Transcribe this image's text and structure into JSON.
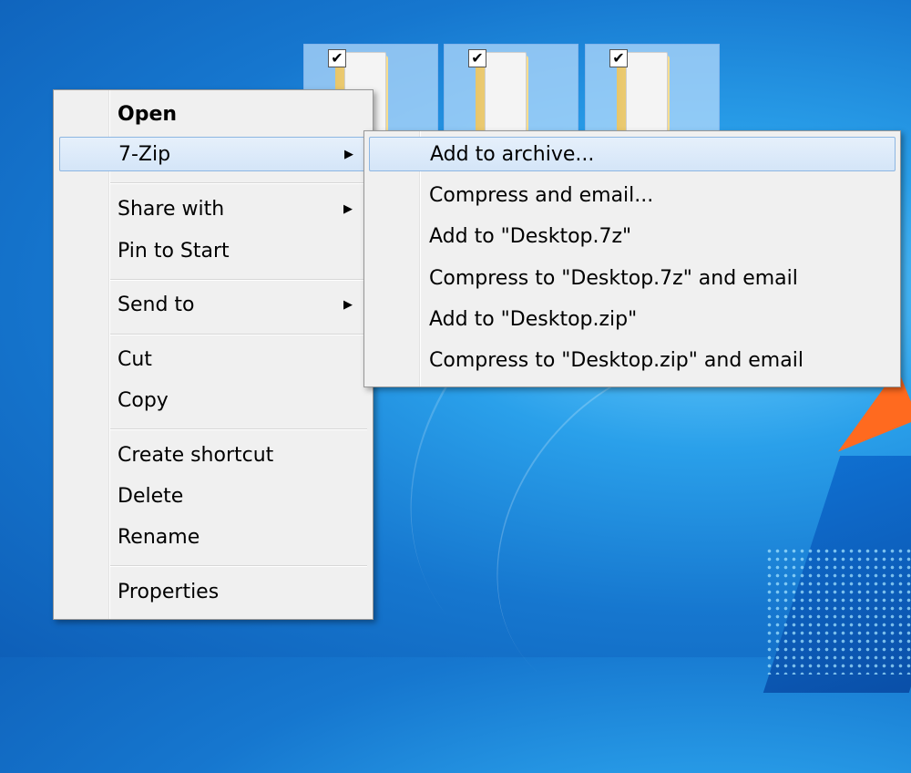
{
  "desktop": {
    "selected_folder_count": 3
  },
  "context_menu": {
    "items": [
      {
        "label": "Open",
        "bold": true
      },
      {
        "label": "7-Zip",
        "submenu": true,
        "highlighted": true
      },
      {
        "label": "Share with",
        "submenu": true
      },
      {
        "label": "Pin to Start"
      },
      {
        "label": "Send to",
        "submenu": true
      },
      {
        "label": "Cut"
      },
      {
        "label": "Copy"
      },
      {
        "label": "Create shortcut"
      },
      {
        "label": "Delete"
      },
      {
        "label": "Rename"
      },
      {
        "label": "Properties"
      }
    ]
  },
  "submenu_7zip": {
    "items": [
      {
        "label": "Add to archive...",
        "highlighted": true
      },
      {
        "label": "Compress and email..."
      },
      {
        "label": "Add to \"Desktop.7z\""
      },
      {
        "label": "Compress to \"Desktop.7z\" and email"
      },
      {
        "label": "Add to \"Desktop.zip\""
      },
      {
        "label": "Compress to \"Desktop.zip\" and email"
      }
    ]
  },
  "colors": {
    "menu_bg": "#f0f0f0",
    "highlight_border": "#8db6e2",
    "desktop_blue": "#1677cf",
    "accent_orange": "#ff6a1f"
  }
}
